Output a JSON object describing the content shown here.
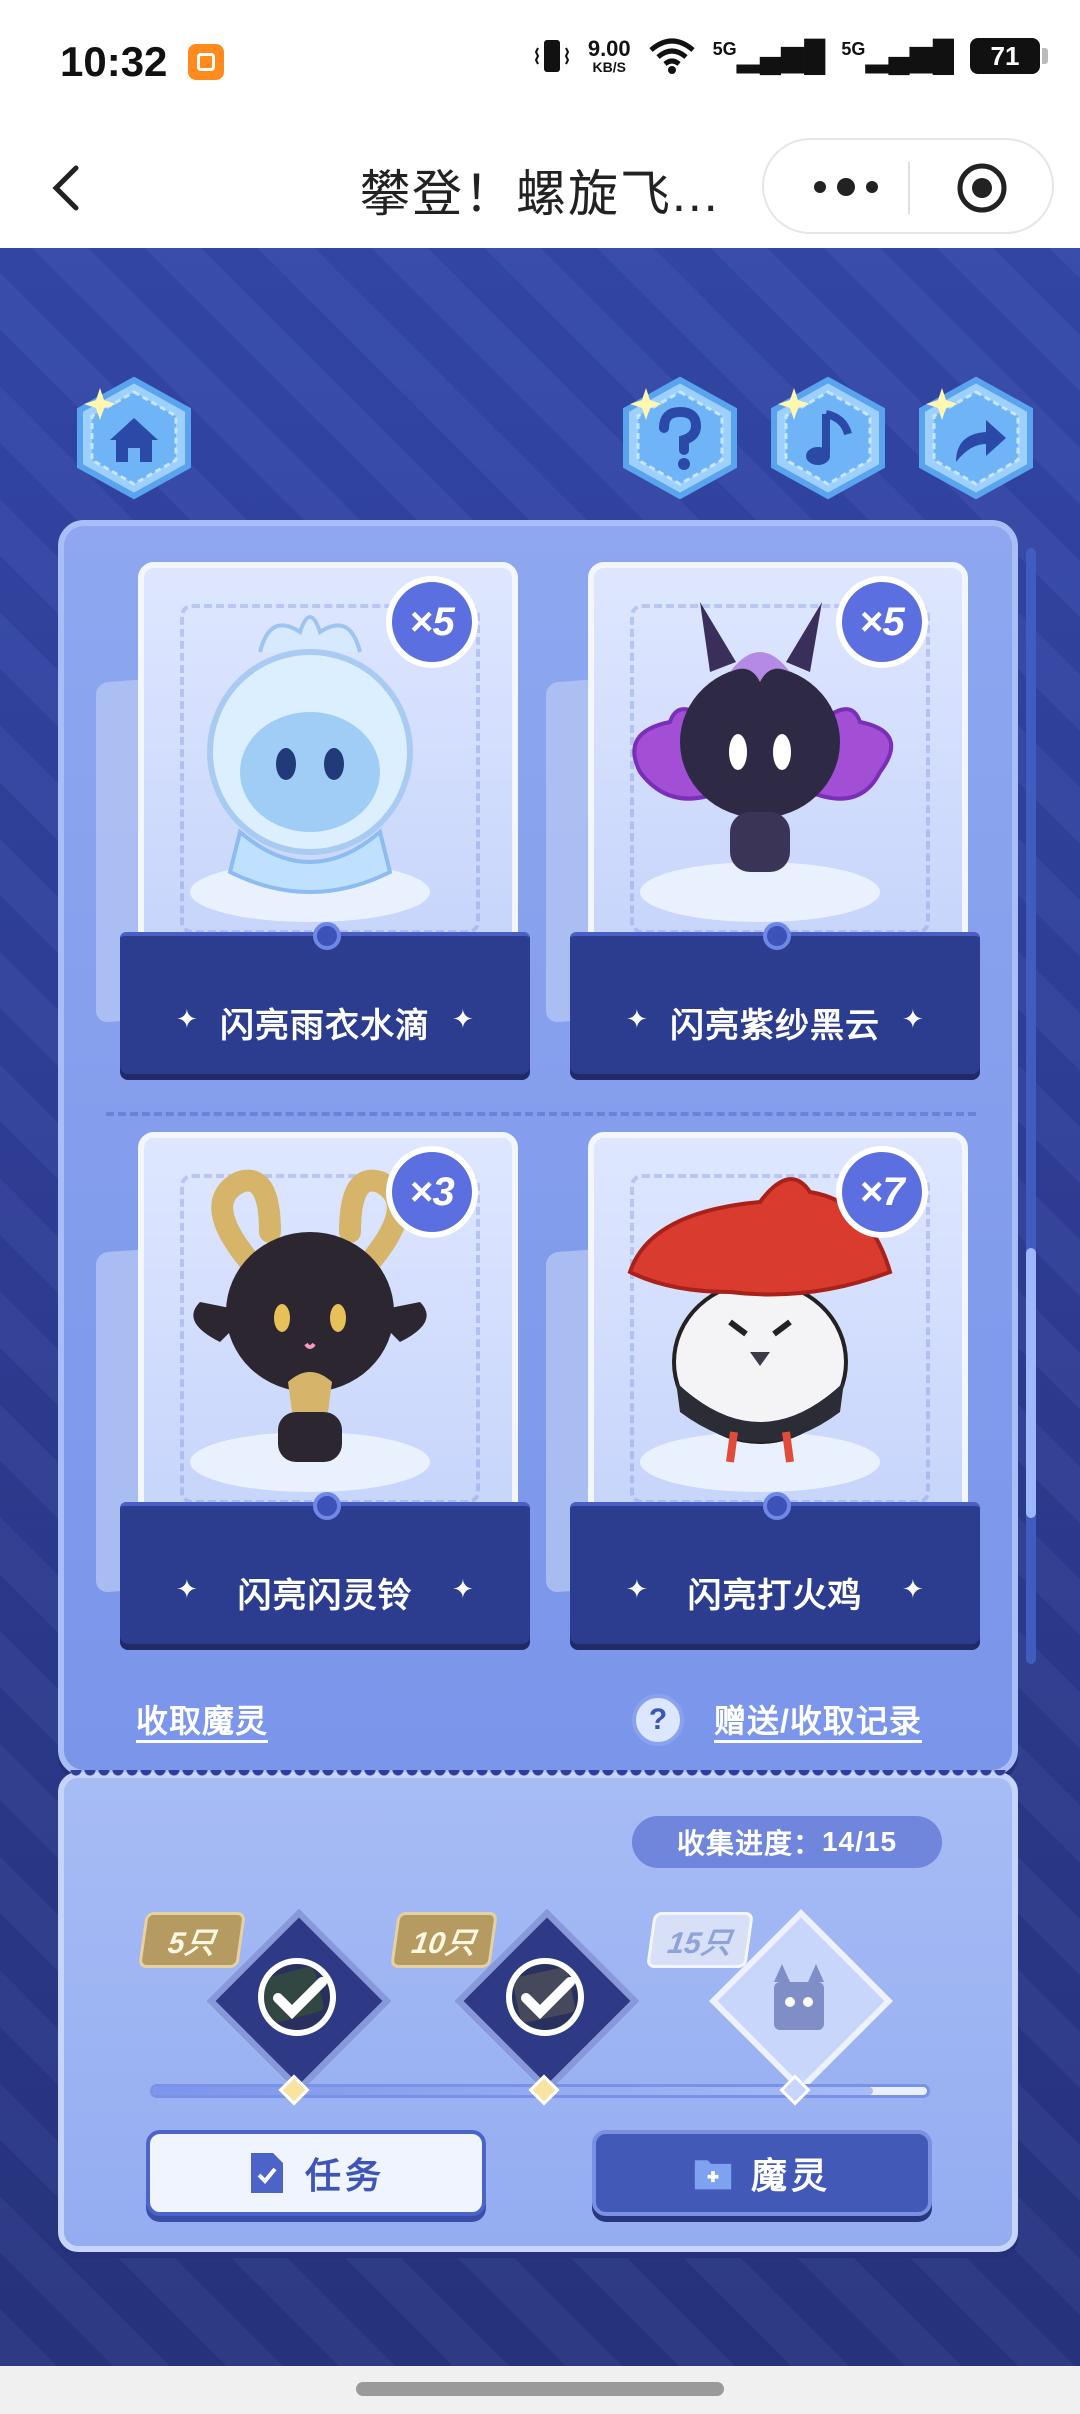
{
  "status_bar": {
    "time": "10:32",
    "speed_value": "9.00",
    "speed_unit": "KB/S",
    "signal_1": "5G",
    "signal_2": "5G",
    "battery": "71"
  },
  "title_bar": {
    "title": "攀登！螺旋飞..."
  },
  "top_buttons": [
    "home-icon",
    "help-icon",
    "music-icon",
    "share-icon"
  ],
  "cards": [
    {
      "name": "闪亮雨衣水滴",
      "count": "×5",
      "art": "water-drop-spirit"
    },
    {
      "name": "闪亮紫纱黑云",
      "count": "×5",
      "art": "black-cloud-spirit"
    },
    {
      "name": "闪亮闪灵铃",
      "count": "×3",
      "art": "goat-bell-spirit"
    },
    {
      "name": "闪亮打火鸡",
      "count": "×7",
      "art": "fire-chick-spirit"
    }
  ],
  "links": {
    "collect": "收取魔灵",
    "records": "赠送/收取记录",
    "help_glyph": "?"
  },
  "progress": {
    "label": "收集进度：",
    "value": "14/15",
    "fraction": 0.93,
    "milestones": [
      {
        "label": "5只",
        "claimed": true
      },
      {
        "label": "10只",
        "claimed": true
      },
      {
        "label": "15只",
        "claimed": false
      }
    ]
  },
  "buttons": {
    "task": "任务",
    "spirit": "魔灵"
  },
  "colors": {
    "accent": "#3f55b8",
    "panel": "#8ea7f0",
    "background": "#2f3f99"
  }
}
